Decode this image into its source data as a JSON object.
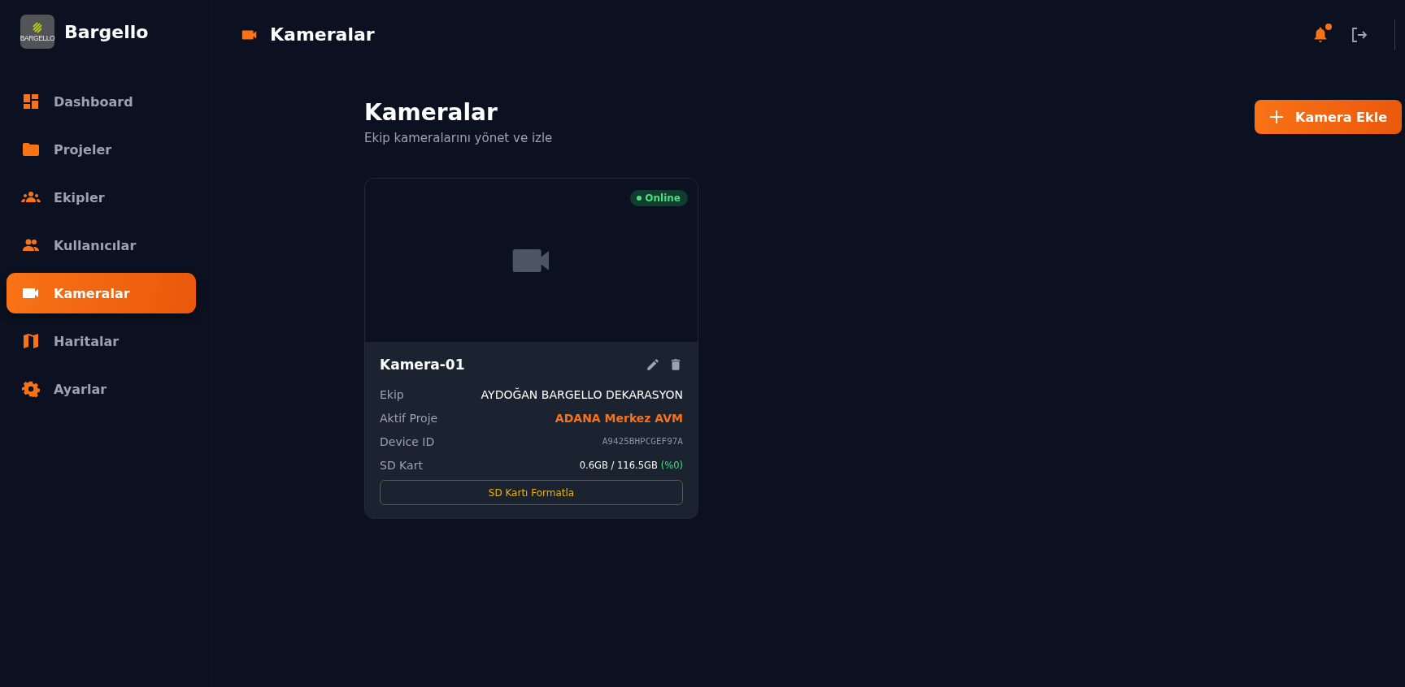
{
  "brand": {
    "logo_text": "BARGELLO",
    "name": "Bargello"
  },
  "sidebar": {
    "items": [
      {
        "label": "Dashboard",
        "selected": false
      },
      {
        "label": "Projeler",
        "selected": false
      },
      {
        "label": "Ekipler",
        "selected": false
      },
      {
        "label": "Kullanıcılar",
        "selected": false
      },
      {
        "label": "Kameralar",
        "selected": true
      },
      {
        "label": "Haritalar",
        "selected": false
      },
      {
        "label": "Ayarlar",
        "selected": false
      }
    ]
  },
  "header": {
    "title": "Kameralar",
    "has_notification": true
  },
  "page": {
    "title": "Kameralar",
    "subtitle": "Ekip kameralarını yönet ve izle",
    "add_button": "Kamera Ekle"
  },
  "cameras": [
    {
      "status": {
        "label": "Online",
        "online": true
      },
      "name": "Kamera-01",
      "fields": [
        {
          "label": "Ekip",
          "value": "AYDOĞAN BARGELLO DEKARASYON",
          "kind": "plain"
        },
        {
          "label": "Aktif Proje",
          "value": "ADANA Merkez AVM",
          "kind": "accent"
        },
        {
          "label": "Device ID",
          "value": "A9425BHPCGEF97A",
          "kind": "mono"
        },
        {
          "label": "SD Kart",
          "value": "0.6GB / 116.5GB",
          "percent": "(%0)",
          "kind": "storage"
        }
      ],
      "format_button": "SD Kartı Formatla"
    }
  ]
}
